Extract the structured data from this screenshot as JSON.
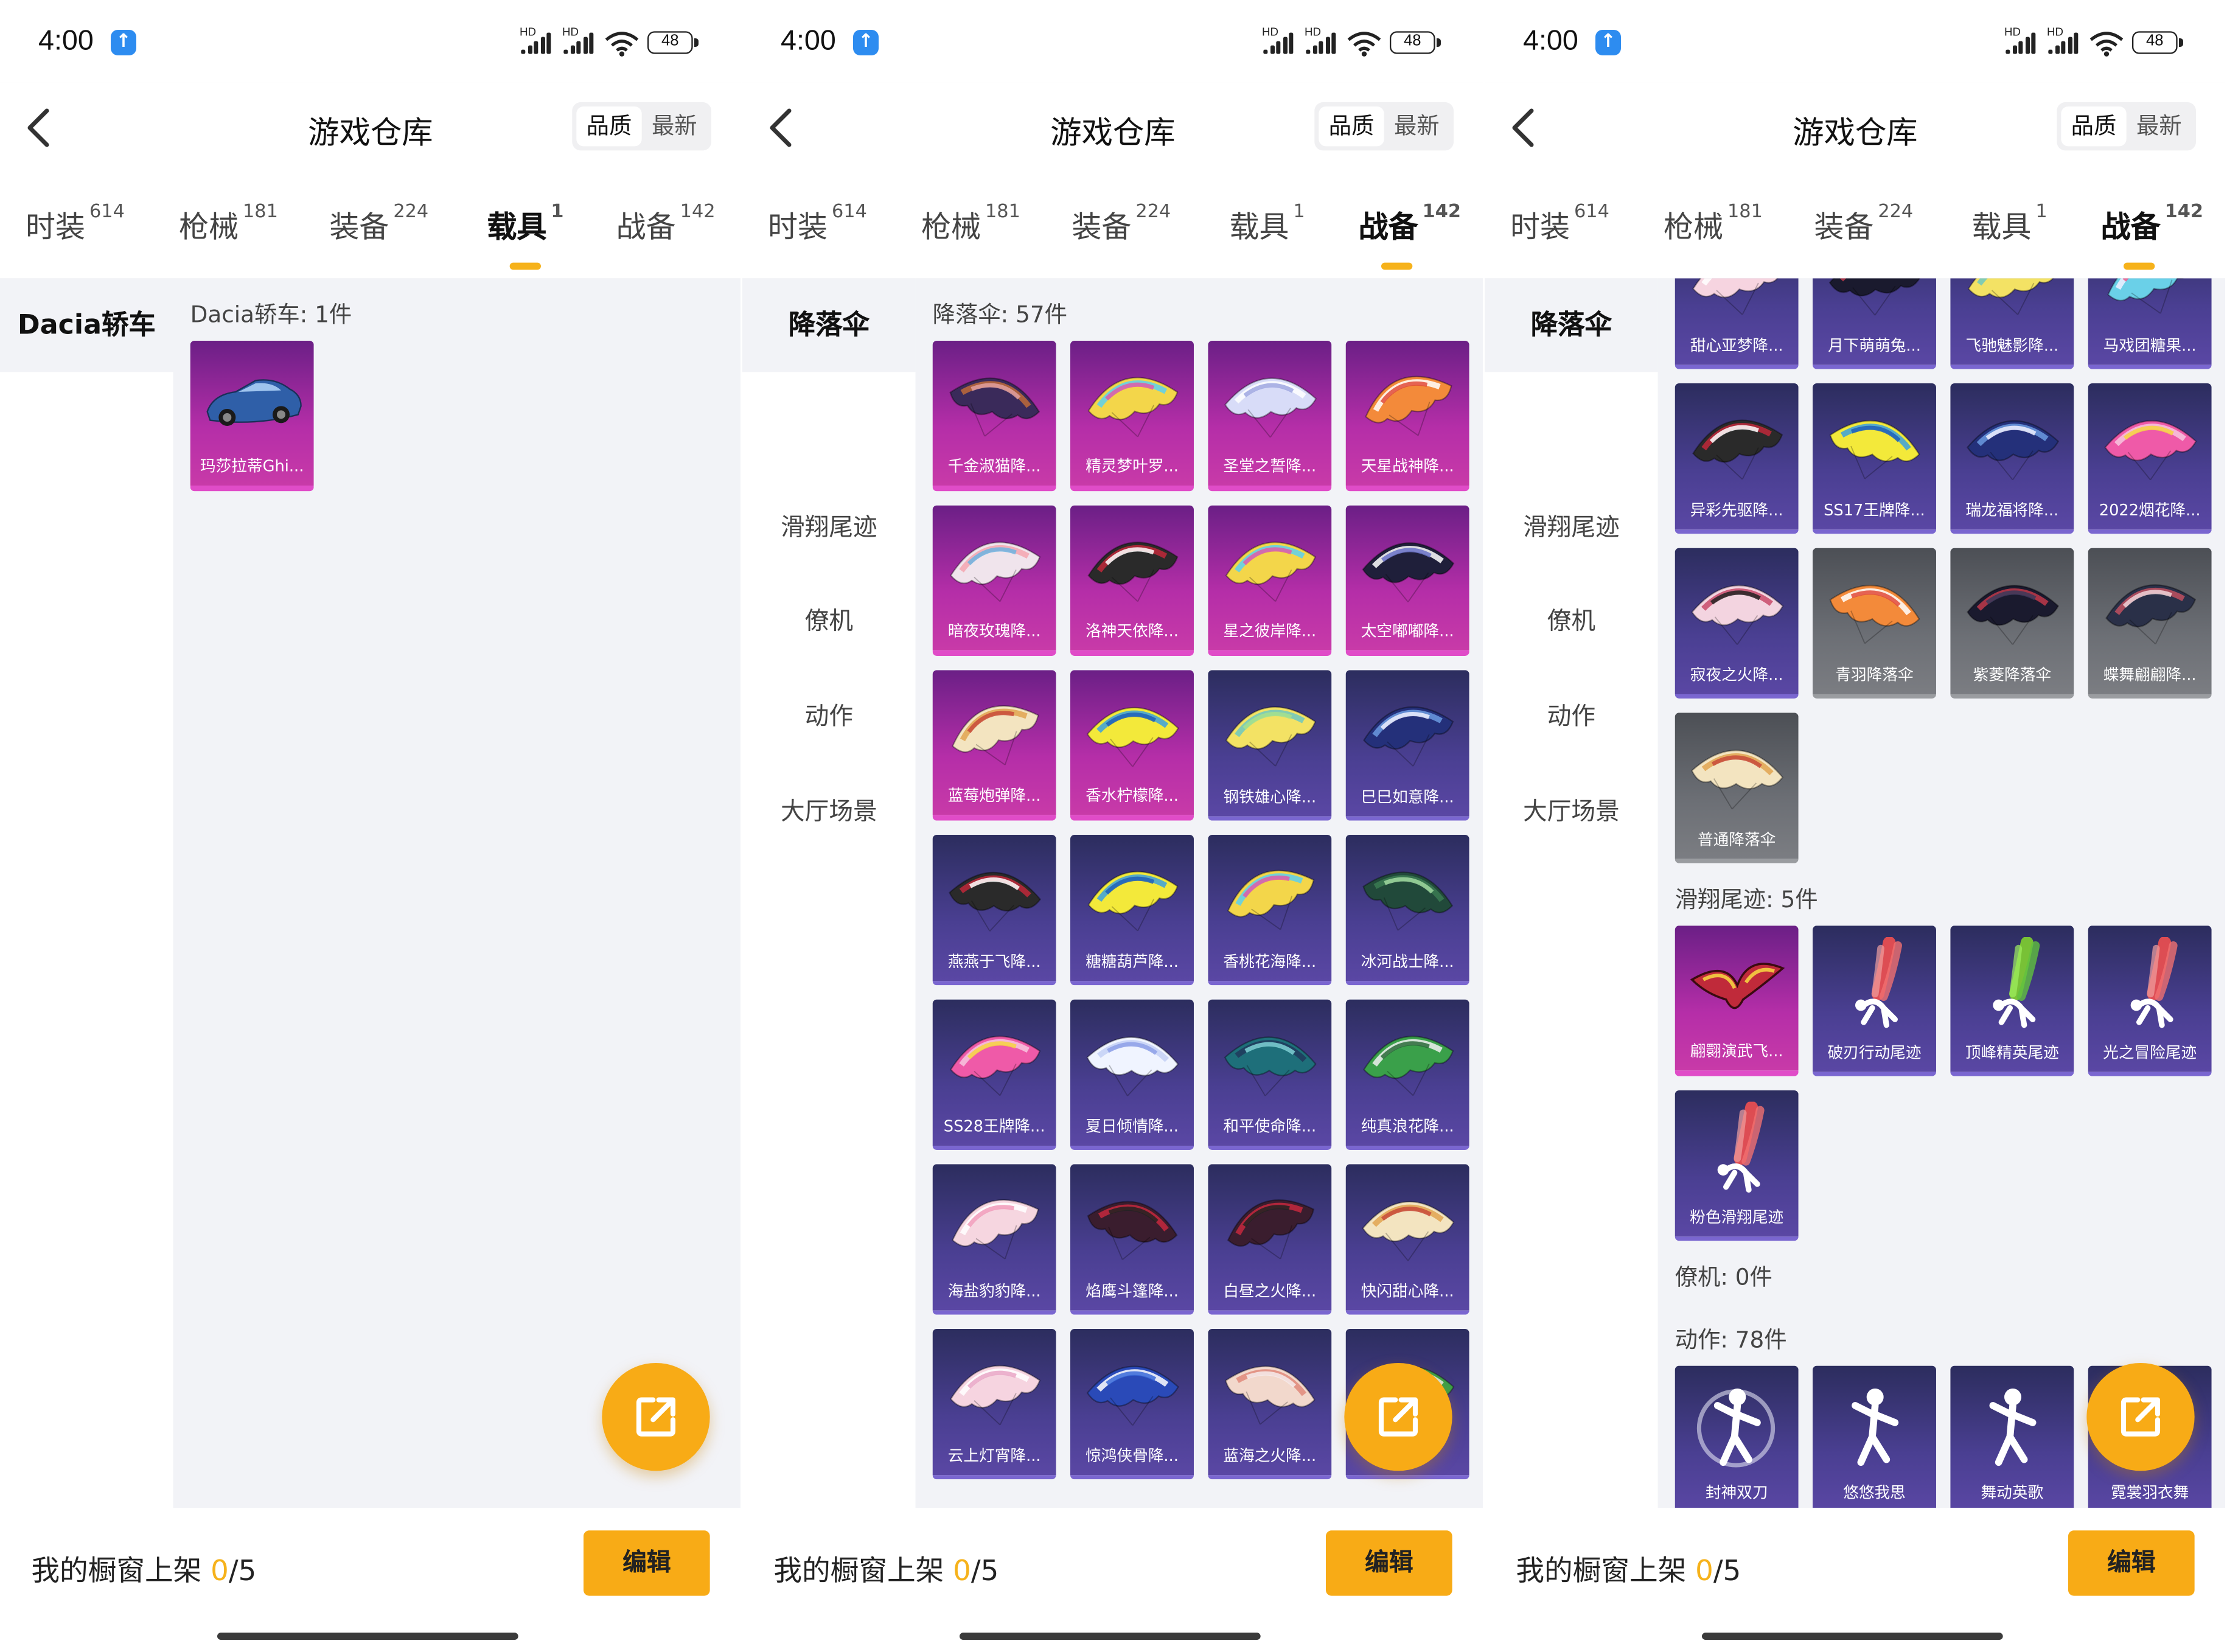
{
  "status": {
    "time": "4:00",
    "hd": "HD",
    "battery": "48"
  },
  "header": {
    "title": "游戏仓库",
    "sort_quality": "品质",
    "sort_latest": "最新"
  },
  "tabs": [
    {
      "label": "时装",
      "count": "614"
    },
    {
      "label": "枪械",
      "count": "181"
    },
    {
      "label": "装备",
      "count": "224"
    },
    {
      "label": "载具",
      "count": "1"
    },
    {
      "label": "战备",
      "count": "142"
    }
  ],
  "bottom": {
    "shelf_prefix": "我的橱窗上架 ",
    "shelf_count": "0",
    "shelf_total": "/5",
    "edit": "编辑"
  },
  "colors": {
    "accent": "#f8ab16",
    "rare_pink": "#b52ea8",
    "epic_purple": "#4a3f92",
    "common_gray": "#6c6f75"
  },
  "screens": [
    {
      "active_tab": 3,
      "side": [
        "Dacia轿车"
      ],
      "sections": [
        {
          "label": "Dacia轿车: 1件",
          "items": [
            {
              "name": "玛莎拉蒂Ghi...",
              "tier": "pink",
              "icon": "car-icon"
            }
          ]
        }
      ]
    },
    {
      "active_tab": 4,
      "side": [
        "降落伞",
        "滑翔尾迹",
        "僚机",
        "动作",
        "大厅场景"
      ],
      "sections": [
        {
          "label": "降落伞: 57件",
          "items": [
            {
              "name": "千金淑猫降...",
              "tier": "pink",
              "icon": "parachute-icon"
            },
            {
              "name": "精灵梦叶罗...",
              "tier": "pink",
              "icon": "parachute-icon"
            },
            {
              "name": "圣堂之誓降...",
              "tier": "pink",
              "icon": "parachute-icon"
            },
            {
              "name": "天星战神降...",
              "tier": "pink",
              "icon": "parachute-icon"
            },
            {
              "name": "暗夜玫瑰降...",
              "tier": "pink",
              "icon": "parachute-icon"
            },
            {
              "name": "洛神天依降...",
              "tier": "pink",
              "icon": "parachute-icon"
            },
            {
              "name": "星之彼岸降...",
              "tier": "pink",
              "icon": "parachute-icon"
            },
            {
              "name": "太空嘟嘟降...",
              "tier": "pink",
              "icon": "parachute-icon"
            },
            {
              "name": "蓝莓炮弹降...",
              "tier": "pink",
              "icon": "parachute-icon"
            },
            {
              "name": "香水柠檬降...",
              "tier": "pink",
              "icon": "parachute-icon"
            },
            {
              "name": "钢铁雄心降...",
              "tier": "purple",
              "icon": "parachute-icon"
            },
            {
              "name": "巳巳如意降...",
              "tier": "purple",
              "icon": "parachute-icon"
            },
            {
              "name": "燕燕于飞降...",
              "tier": "purple",
              "icon": "parachute-icon"
            },
            {
              "name": "糖糖葫芦降...",
              "tier": "purple",
              "icon": "parachute-icon"
            },
            {
              "name": "香桃花海降...",
              "tier": "purple",
              "icon": "parachute-icon"
            },
            {
              "name": "冰河战士降...",
              "tier": "purple",
              "icon": "parachute-icon"
            },
            {
              "name": "SS28王牌降...",
              "tier": "purple",
              "icon": "parachute-icon"
            },
            {
              "name": "夏日倾情降...",
              "tier": "purple",
              "icon": "parachute-icon"
            },
            {
              "name": "和平使命降...",
              "tier": "purple",
              "icon": "parachute-icon"
            },
            {
              "name": "纯真浪花降...",
              "tier": "purple",
              "icon": "parachute-icon"
            },
            {
              "name": "海盐豹豹降...",
              "tier": "purple",
              "icon": "parachute-icon"
            },
            {
              "name": "焰鹰斗篷降...",
              "tier": "purple",
              "icon": "parachute-icon"
            },
            {
              "name": "白昼之火降...",
              "tier": "purple",
              "icon": "parachute-icon"
            },
            {
              "name": "快闪甜心降...",
              "tier": "purple",
              "icon": "parachute-icon"
            },
            {
              "name": "云上灯宵降...",
              "tier": "purple",
              "icon": "parachute-icon"
            },
            {
              "name": "惊鸿侠骨降...",
              "tier": "purple",
              "icon": "parachute-icon"
            },
            {
              "name": "蓝海之火降...",
              "tier": "purple",
              "icon": "parachute-icon"
            },
            {
              "name": "",
              "tier": "purple",
              "icon": "parachute-icon"
            }
          ]
        }
      ]
    },
    {
      "active_tab": 4,
      "side": [
        "降落伞",
        "滑翔尾迹",
        "僚机",
        "动作",
        "大厅场景"
      ],
      "sections": [
        {
          "label": "",
          "items": [
            {
              "name": "甜心亚梦降...",
              "tier": "purple",
              "icon": "parachute-icon"
            },
            {
              "name": "月下萌萌兔...",
              "tier": "purple",
              "icon": "parachute-icon"
            },
            {
              "name": "飞驰魅影降...",
              "tier": "purple",
              "icon": "parachute-icon"
            },
            {
              "name": "马戏团糖果...",
              "tier": "purple",
              "icon": "parachute-icon"
            },
            {
              "name": "异彩先驱降...",
              "tier": "purple",
              "icon": "parachute-icon"
            },
            {
              "name": "SS17王牌降...",
              "tier": "purple",
              "icon": "parachute-icon"
            },
            {
              "name": "瑞龙福将降...",
              "tier": "purple",
              "icon": "parachute-icon"
            },
            {
              "name": "2022烟花降...",
              "tier": "purple",
              "icon": "parachute-icon"
            },
            {
              "name": "寂夜之火降...",
              "tier": "purple",
              "icon": "parachute-icon"
            },
            {
              "name": "青羽降落伞",
              "tier": "gray",
              "icon": "parachute-icon"
            },
            {
              "name": "紫菱降落伞",
              "tier": "gray",
              "icon": "parachute-icon"
            },
            {
              "name": "蝶舞翩翩降...",
              "tier": "gray",
              "icon": "parachute-icon"
            },
            {
              "name": "普通降落伞",
              "tier": "gray",
              "icon": "parachute-icon"
            }
          ]
        },
        {
          "label": "滑翔尾迹: 5件",
          "items": [
            {
              "name": "翩翾演武飞...",
              "tier": "pink",
              "icon": "glider-icon"
            },
            {
              "name": "破刃行动尾迹",
              "tier": "purple",
              "icon": "trail-icon"
            },
            {
              "name": "顶峰精英尾迹",
              "tier": "purple",
              "icon": "trail-icon"
            },
            {
              "name": "光之冒险尾迹",
              "tier": "purple",
              "icon": "trail-icon"
            },
            {
              "name": "粉色滑翔尾迹",
              "tier": "purple",
              "icon": "trail-icon"
            }
          ]
        },
        {
          "label": "僚机: 0件",
          "items": []
        },
        {
          "label": "动作: 78件",
          "items": [
            {
              "name": "封神双刀",
              "tier": "purple",
              "icon": "emote-icon"
            },
            {
              "name": "悠悠我思",
              "tier": "purple",
              "icon": "emote-icon"
            },
            {
              "name": "舞动英歌",
              "tier": "purple",
              "icon": "emote-icon"
            },
            {
              "name": "霓裳羽衣舞",
              "tier": "purple",
              "icon": "emote-icon"
            }
          ]
        }
      ]
    }
  ]
}
